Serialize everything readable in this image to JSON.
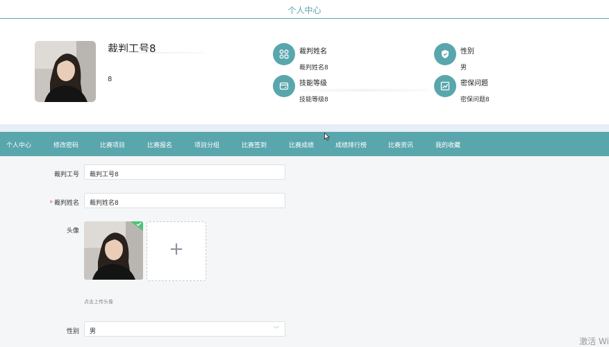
{
  "header": {
    "title": "个人中心"
  },
  "profile": {
    "name": "裁判工号8",
    "sub": "8",
    "fields": [
      {
        "label": "裁判姓名",
        "value": "裁判姓名8",
        "icon": "grid-icon"
      },
      {
        "label": "性别",
        "value": "男",
        "icon": "shield-check-icon"
      },
      {
        "label": "技能等级",
        "value": "技能等级8",
        "icon": "card-icon"
      },
      {
        "label": "密保问题",
        "value": "密保问题8",
        "icon": "chart-icon"
      }
    ]
  },
  "nav": {
    "items": [
      "个人中心",
      "修改密码",
      "比赛项目",
      "比赛报名",
      "项目分组",
      "比赛签到",
      "比赛成绩",
      "成绩排行榜",
      "比赛资讯",
      "我的收藏"
    ]
  },
  "form": {
    "id_label": "裁判工号",
    "id_value": "裁判工号8",
    "name_required": "*",
    "name_label": "裁判姓名",
    "name_value": "裁判姓名8",
    "avatar_label": "头像",
    "upload_plus": "+",
    "upload_hint": "点击上传头像",
    "gender_label": "性别",
    "gender_value": "男",
    "gender_arrow": "﹀"
  },
  "watermark": "激活 Wi",
  "colors": {
    "accent": "#5aa6ad",
    "success": "#4cc377"
  }
}
